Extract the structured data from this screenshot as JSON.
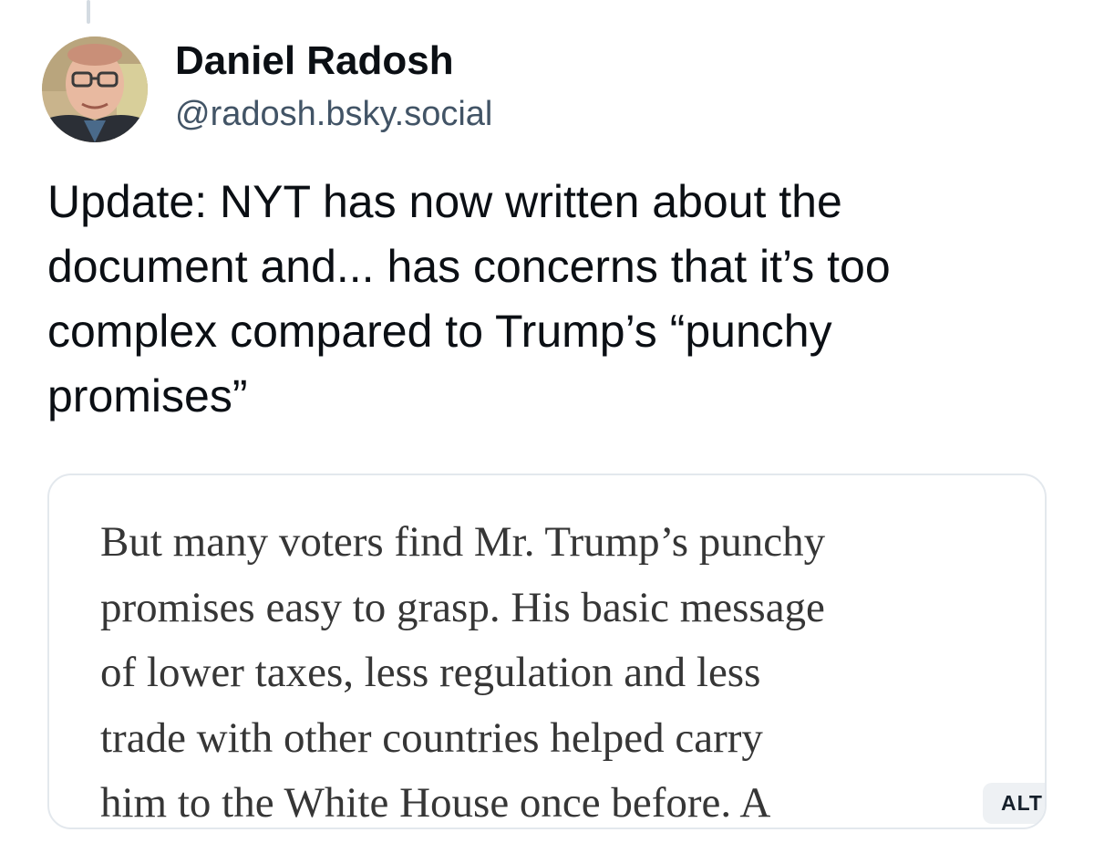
{
  "post": {
    "author": {
      "display_name": "Daniel Radosh",
      "handle": "@radosh.bsky.social",
      "avatar_icon": "person-photo"
    },
    "text_lines": [
      "Update: NYT has now written about the",
      "document and... has concerns that it’s too",
      "complex compared to Trump’s “punchy",
      "promises”"
    ],
    "image": {
      "text_lines": [
        "But many voters find Mr. Trump’s punchy",
        "promises easy to grasp. His basic message",
        "of lower taxes, less regulation and less",
        "trade with other countries helped carry",
        "him to the White House once before. A"
      ],
      "alt_badge": "ALT"
    }
  },
  "colors": {
    "name": "#0b0f14",
    "handle": "#425466",
    "card_border": "#e3e8ed",
    "quote_text": "#363636",
    "alt_badge_bg": "#eef1f4",
    "thread_line": "#d4dbe2"
  }
}
